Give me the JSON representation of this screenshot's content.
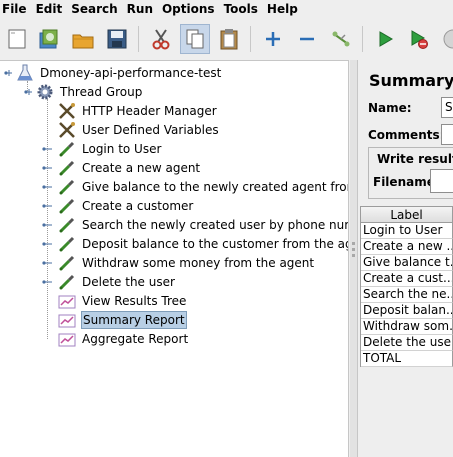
{
  "menu": [
    "File",
    "Edit",
    "Search",
    "Run",
    "Options",
    "Tools",
    "Help"
  ],
  "toolbar": {
    "buttons": [
      "new-icon",
      "templates-icon",
      "open-icon",
      "save-icon",
      "cut-icon",
      "copy-icon",
      "paste-icon",
      "expand-icon",
      "collapse-icon",
      "toggle-icon",
      "start-icon",
      "start-no-pauses-icon",
      "stop-icon"
    ]
  },
  "tree": {
    "test_plan": "Dmoney-api-performance-test",
    "thread_group": "Thread Group",
    "children": [
      {
        "label": "HTTP Header Manager",
        "icon": "wrench-scissors-icon"
      },
      {
        "label": "User Defined Variables",
        "icon": "wrench-scissors-icon"
      },
      {
        "label": "Login to User",
        "icon": "pipette-icon"
      },
      {
        "label": "Create a new agent",
        "icon": "pipette-icon"
      },
      {
        "label": "Give balance to the newly created agent from sys",
        "icon": "pipette-icon"
      },
      {
        "label": "Create a customer",
        "icon": "pipette-icon"
      },
      {
        "label": "Search the newly created user by phone number",
        "icon": "pipette-icon"
      },
      {
        "label": "Deposit balance to the customer from the agent",
        "icon": "pipette-icon"
      },
      {
        "label": "Withdraw some money from the agent",
        "icon": "pipette-icon"
      },
      {
        "label": "Delete the user",
        "icon": "pipette-icon"
      },
      {
        "label": "View Results Tree",
        "icon": "chart-icon"
      },
      {
        "label": "Summary Report",
        "icon": "chart-icon"
      },
      {
        "label": "Aggregate Report",
        "icon": "chart-icon"
      }
    ]
  },
  "panel": {
    "title": "Summary R",
    "name_label": "Name:",
    "name_value": "Su",
    "comments_label": "Comments:",
    "write_results_label": "Write results",
    "filename_label": "Filename",
    "table_header": "Label",
    "rows": [
      "Login to User",
      "Create a new ...",
      "Give balance t...",
      "Create a cust...",
      "Search the ne...",
      "Deposit balan...",
      "Withdraw som...",
      "Delete the user",
      "TOTAL"
    ]
  },
  "colors": {
    "selection_bg": "#b8cfe5",
    "window_bg": "#eeeeee"
  }
}
